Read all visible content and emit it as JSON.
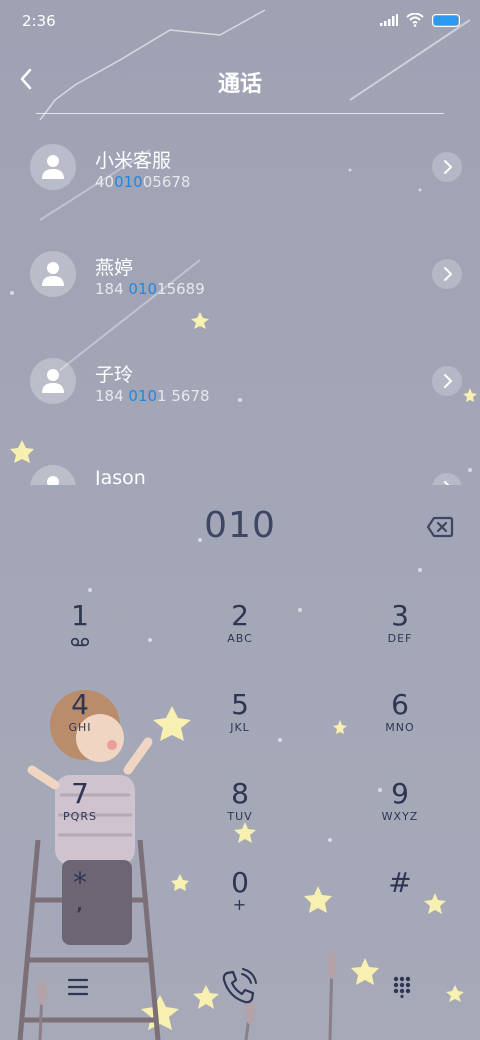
{
  "status_bar": {
    "time": "2:36"
  },
  "header": {
    "title": "通话"
  },
  "contacts": [
    {
      "name": "小米客服",
      "number_pre": "40",
      "number_match": "010",
      "number_post": "05678"
    },
    {
      "name": "燕婷",
      "number_pre": "184 ",
      "number_match": "010",
      "number_post": "15689"
    },
    {
      "name": "子玲",
      "number_pre": "184 ",
      "number_match": "010",
      "number_post": "1 5678"
    },
    {
      "name": "Jason",
      "number_pre": "",
      "number_match": "",
      "number_post": ""
    }
  ],
  "dialer": {
    "input": "010"
  },
  "keypad": [
    {
      "digit": "1",
      "letters": ""
    },
    {
      "digit": "2",
      "letters": "ABC"
    },
    {
      "digit": "3",
      "letters": "DEF"
    },
    {
      "digit": "4",
      "letters": "GHI"
    },
    {
      "digit": "5",
      "letters": "JKL"
    },
    {
      "digit": "6",
      "letters": "MNO"
    },
    {
      "digit": "7",
      "letters": "PQRS"
    },
    {
      "digit": "8",
      "letters": "TUV"
    },
    {
      "digit": "9",
      "letters": "WXYZ"
    },
    {
      "digit": "*",
      "letters": ","
    },
    {
      "digit": "0",
      "letters": "+"
    },
    {
      "digit": "#",
      "letters": ""
    }
  ],
  "icons": {
    "voicemail": "voicemail-icon",
    "menu": "menu-icon",
    "call": "call-icon",
    "keypad_toggle": "dialpad-icon",
    "backspace": "backspace-icon"
  },
  "colors": {
    "highlight": "#1e88e5",
    "key_text": "#2f3654",
    "star": "#f8f0b0"
  }
}
